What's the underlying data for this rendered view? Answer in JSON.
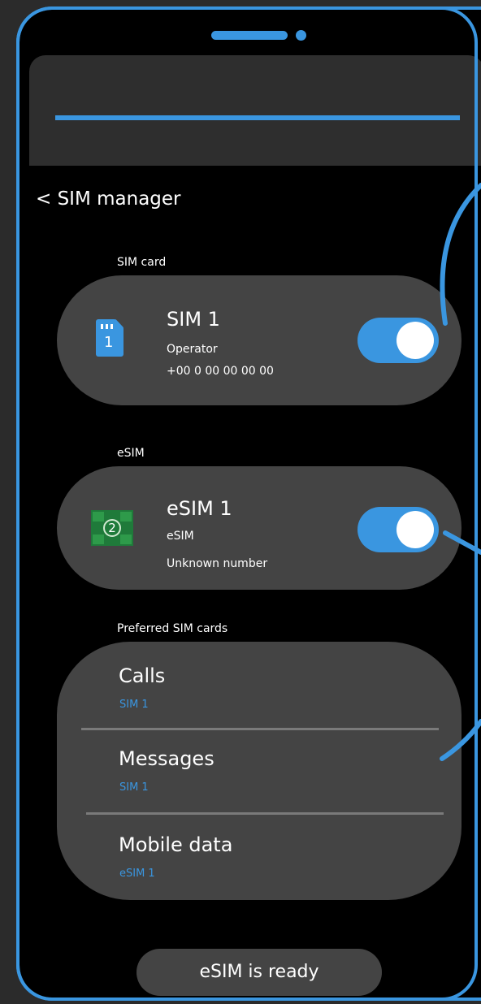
{
  "header": {
    "back_title": "< SIM manager"
  },
  "sections": {
    "sim_card_label": "SIM card",
    "esim_label": "eSIM",
    "preferred_label": "Preferred SIM cards"
  },
  "sim_card": {
    "icon_number": "1",
    "title": "SIM 1",
    "operator": "Operator",
    "number": "+00 0 00 00 00 00",
    "enabled": true
  },
  "esim": {
    "icon_number": "2",
    "title": "eSIM 1",
    "subtitle": "eSIM",
    "number": "Unknown number",
    "enabled": true
  },
  "preferred": {
    "items": [
      {
        "label": "Calls",
        "value": "SIM 1"
      },
      {
        "label": "Messages",
        "value": "SIM 1"
      },
      {
        "label": "Mobile data",
        "value": "eSIM 1"
      }
    ]
  },
  "status": {
    "text": "eSIM is ready"
  },
  "colors": {
    "accent": "#3a96e0",
    "card": "#444444",
    "background": "#000000",
    "chip_green": "#1f7a3a"
  },
  "icons": [
    "sim-card-icon",
    "esim-chip-icon"
  ]
}
